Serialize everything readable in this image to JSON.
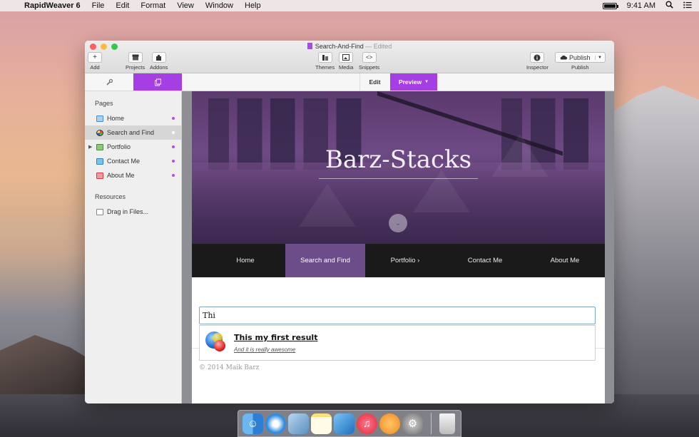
{
  "menubar": {
    "app_name": "RapidWeaver 6",
    "items": [
      "File",
      "Edit",
      "Format",
      "View",
      "Window",
      "Help"
    ],
    "time": "9:41 AM"
  },
  "window": {
    "title": "Search-And-Find",
    "status": "Edited",
    "toolbar": {
      "add": "Add",
      "projects": "Projects",
      "addons": "Addons",
      "themes": "Themes",
      "media": "Media",
      "snippets": "Snippets",
      "inspector": "Inspector",
      "publish_button": "Publish",
      "publish_label": "Publish"
    },
    "modes": {
      "edit": "Edit",
      "preview": "Preview"
    }
  },
  "sidebar": {
    "pages_heading": "Pages",
    "pages": [
      {
        "label": "Home"
      },
      {
        "label": "Search and Find"
      },
      {
        "label": "Portfolio"
      },
      {
        "label": "Contact Me"
      },
      {
        "label": "About Me"
      }
    ],
    "resources_heading": "Resources",
    "resources_item": "Drag in Files..."
  },
  "site": {
    "hero_title": "Barz-Stacks",
    "nav": [
      "Home",
      "Search and Find",
      "Portfolio ›",
      "Contact Me",
      "About Me"
    ],
    "search_value": "Thi",
    "result": {
      "title": "This my first result",
      "description": "And it is really awesome"
    },
    "footer": "© 2014 Maik Barz"
  },
  "colors": {
    "accent": "#a53ee3",
    "nav_active": "#6d4c8a"
  },
  "dock": {
    "icons": [
      "finder-icon",
      "safari-icon",
      "preview-icon",
      "notes-icon",
      "xcode-icon",
      "itunes-icon",
      "ibooks-icon",
      "system-preferences-icon",
      "trash-icon"
    ]
  }
}
